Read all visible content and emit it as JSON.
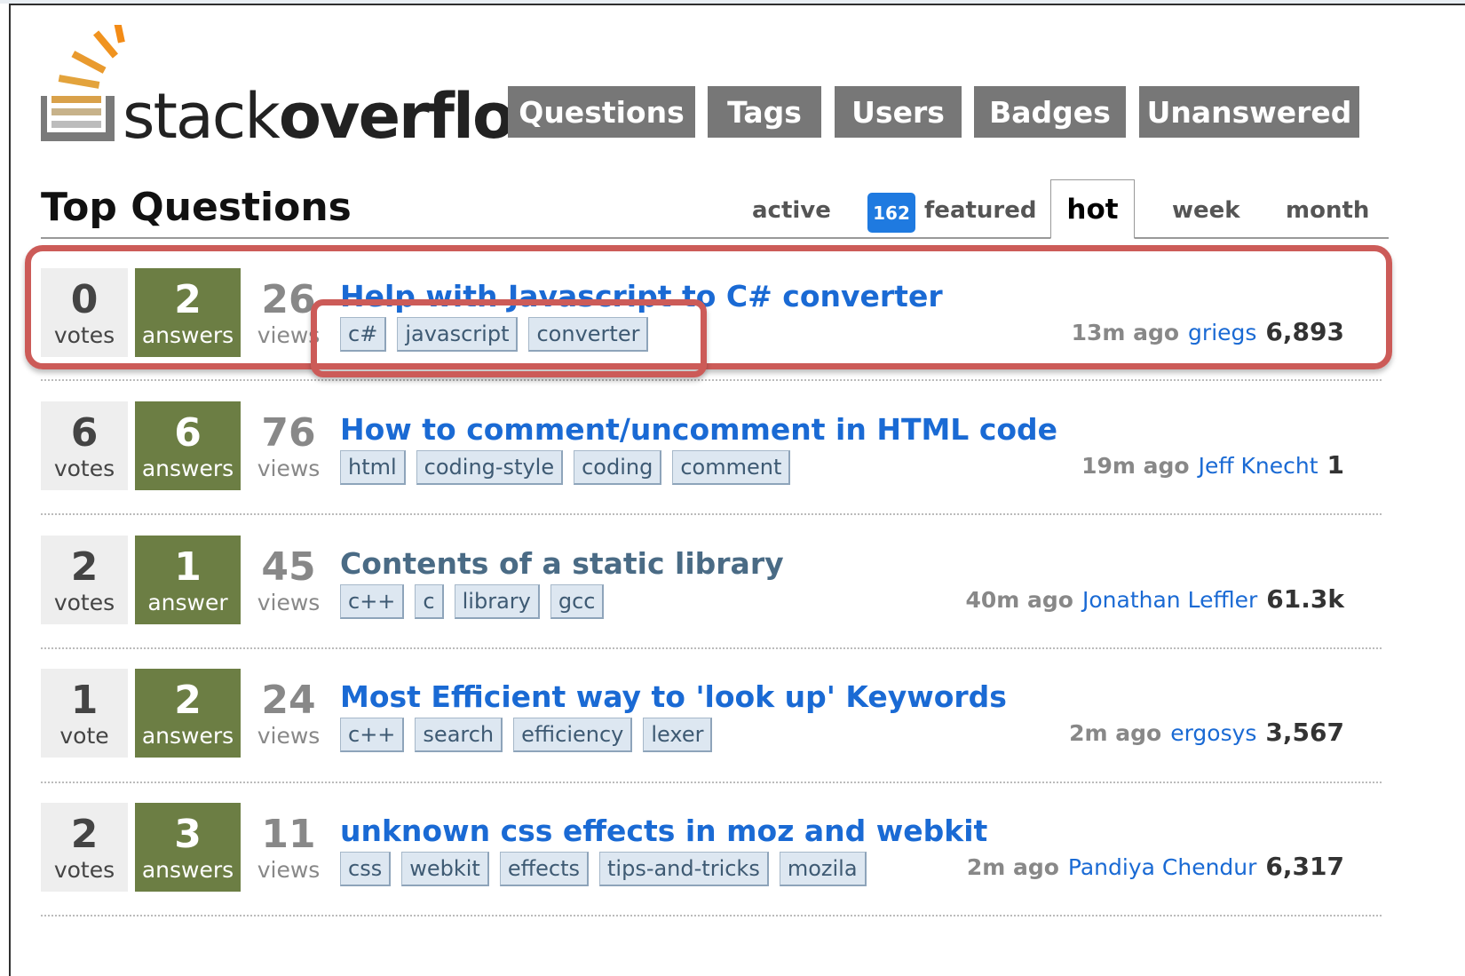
{
  "logo": {
    "text_light": "stack",
    "text_bold": "overflow"
  },
  "nav": [
    {
      "label": "Questions"
    },
    {
      "label": "Tags"
    },
    {
      "label": "Users"
    },
    {
      "label": "Badges"
    },
    {
      "label": "Unanswered"
    }
  ],
  "page_title": "Top Questions",
  "tabs": {
    "active": "active",
    "featured_count": "162",
    "featured": "featured",
    "hot": "hot",
    "week": "week",
    "month": "month"
  },
  "colors": {
    "answered_green": "#6c7e44",
    "link_blue": "#1a6ad4",
    "highlight_red": "#cc5b58",
    "featured_blue": "#1f7ae0",
    "nav_gray": "#777777"
  },
  "questions": [
    {
      "votes": "0",
      "votes_label": "votes",
      "answers": "2",
      "answers_label": "answers",
      "views": "26",
      "views_label": "views",
      "title": "Help with Javascript to C# converter",
      "tags": [
        "c#",
        "javascript",
        "converter"
      ],
      "ago": "13m ago",
      "user": "griegs",
      "rep": "6,893"
    },
    {
      "votes": "6",
      "votes_label": "votes",
      "answers": "6",
      "answers_label": "answers",
      "views": "76",
      "views_label": "views",
      "title": "How to comment/uncomment in HTML code",
      "tags": [
        "html",
        "coding-style",
        "coding",
        "comment"
      ],
      "ago": "19m ago",
      "user": "Jeff Knecht",
      "rep": "1"
    },
    {
      "votes": "2",
      "votes_label": "votes",
      "answers": "1",
      "answers_label": "answer",
      "views": "45",
      "views_label": "views",
      "title": "Contents of a static library",
      "tags": [
        "c++",
        "c",
        "library",
        "gcc"
      ],
      "ago": "40m ago",
      "user": "Jonathan Leffler",
      "rep": "61.3k"
    },
    {
      "votes": "1",
      "votes_label": "vote",
      "answers": "2",
      "answers_label": "answers",
      "views": "24",
      "views_label": "views",
      "title": "Most Efficient way to 'look up' Keywords",
      "tags": [
        "c++",
        "search",
        "efficiency",
        "lexer"
      ],
      "ago": "2m ago",
      "user": "ergosys",
      "rep": "3,567"
    },
    {
      "votes": "2",
      "votes_label": "votes",
      "answers": "3",
      "answers_label": "answers",
      "views": "11",
      "views_label": "views",
      "title": "unknown css effects in moz and webkit",
      "tags": [
        "css",
        "webkit",
        "effects",
        "tips-and-tricks",
        "mozila"
      ],
      "ago": "2m ago",
      "user": "Pandiya Chendur",
      "rep": "6,317"
    }
  ]
}
